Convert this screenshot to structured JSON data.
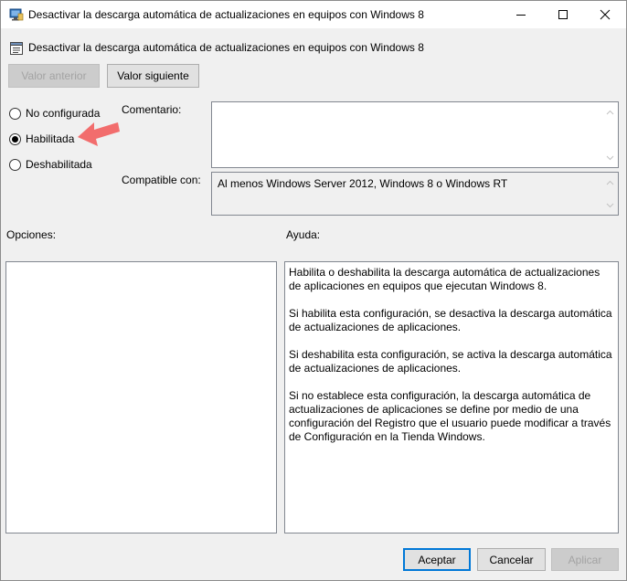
{
  "window": {
    "title": "Desactivar la descarga automática de actualizaciones en equipos con Windows 8"
  },
  "header": {
    "policy_title": "Desactivar la descarga automática de actualizaciones en equipos con Windows 8"
  },
  "nav": {
    "prev_label": "Valor anterior",
    "next_label": "Valor siguiente"
  },
  "state": {
    "options": [
      {
        "label": "No configurada",
        "selected": false
      },
      {
        "label": "Habilitada",
        "selected": true
      },
      {
        "label": "Deshabilitada",
        "selected": false
      }
    ]
  },
  "comment": {
    "label": "Comentario:",
    "value": ""
  },
  "supported": {
    "label": "Compatible con:",
    "value": "Al menos Windows Server 2012, Windows 8 o Windows RT"
  },
  "options_panel": {
    "label": "Opciones:"
  },
  "help_panel": {
    "label": "Ayuda:",
    "paragraphs": [
      "Habilita o deshabilita la descarga automática de actualizaciones de aplicaciones en equipos que ejecutan Windows 8.",
      "Si habilita esta configuración, se desactiva la descarga automática de actualizaciones de aplicaciones.",
      "Si deshabilita esta configuración, se activa la descarga automática de actualizaciones de aplicaciones.",
      "Si no establece esta configuración, la descarga automática de actualizaciones de aplicaciones se define por medio de una configuración del Registro que el usuario puede modificar a través de Configuración en la Tienda Windows."
    ]
  },
  "footer": {
    "ok_label": "Aceptar",
    "cancel_label": "Cancelar",
    "apply_label": "Aplicar"
  },
  "colors": {
    "annotation_arrow": "#f26d6d",
    "focus_border": "#0078d7"
  }
}
